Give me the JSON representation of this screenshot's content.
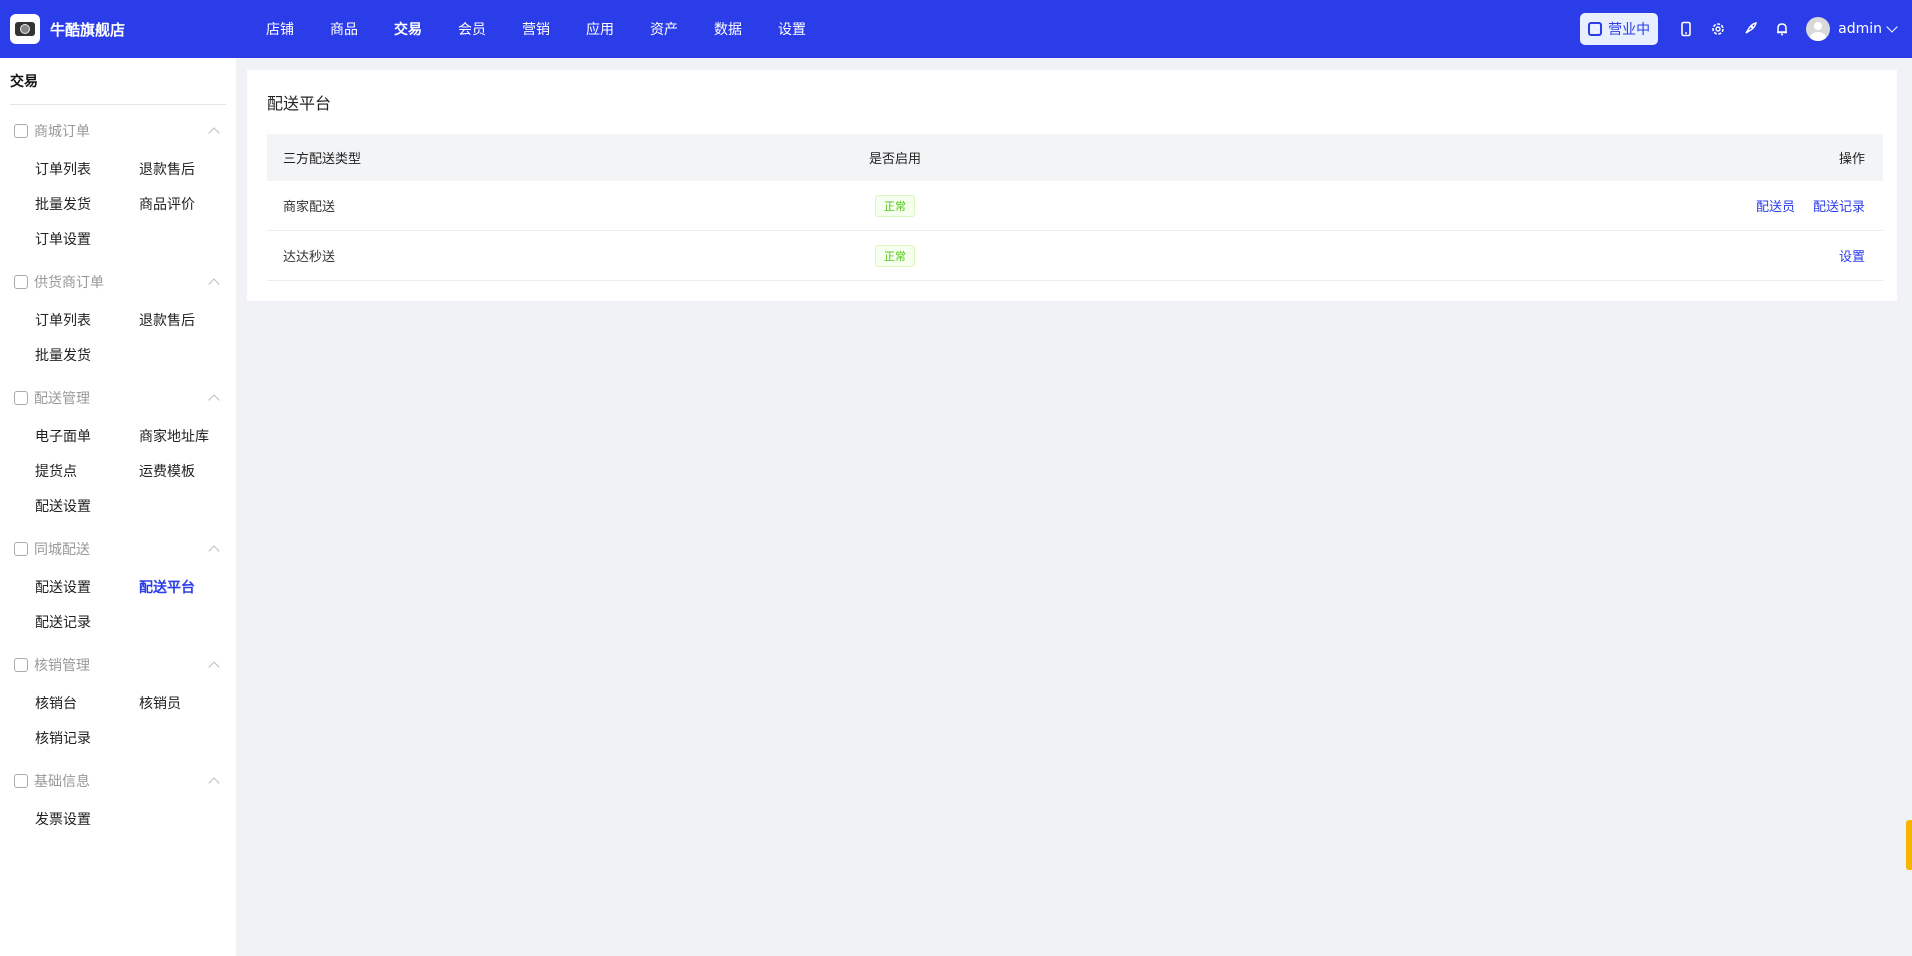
{
  "brand": {
    "name": "牛酷旗舰店",
    "logo_icon": "camera-logo"
  },
  "topnav": [
    {
      "label": "店铺",
      "active": false
    },
    {
      "label": "商品",
      "active": false
    },
    {
      "label": "交易",
      "active": true
    },
    {
      "label": "会员",
      "active": false
    },
    {
      "label": "营销",
      "active": false
    },
    {
      "label": "应用",
      "active": false
    },
    {
      "label": "资产",
      "active": false
    },
    {
      "label": "数据",
      "active": false
    },
    {
      "label": "设置",
      "active": false
    }
  ],
  "header": {
    "status_label": "营业中",
    "username": "admin"
  },
  "sidebar": {
    "title": "交易",
    "groups": [
      {
        "name": "商城订单",
        "icon": "order-icon",
        "items": [
          "订单列表",
          "退款售后",
          "批量发货",
          "商品评价",
          "订单设置"
        ]
      },
      {
        "name": "供货商订单",
        "icon": "supplier-icon",
        "items": [
          "订单列表",
          "退款售后",
          "批量发货"
        ]
      },
      {
        "name": "配送管理",
        "icon": "delivery-icon",
        "items": [
          "电子面单",
          "商家地址库",
          "提货点",
          "运费模板",
          "配送设置"
        ]
      },
      {
        "name": "同城配送",
        "icon": "truck-icon",
        "items": [
          "配送设置",
          "配送平台",
          "配送记录"
        ],
        "active": "配送平台"
      },
      {
        "name": "核销管理",
        "icon": "verify-icon",
        "items": [
          "核销台",
          "核销员",
          "核销记录"
        ]
      },
      {
        "name": "基础信息",
        "icon": "info-icon",
        "items": [
          "发票设置"
        ]
      }
    ]
  },
  "main": {
    "title": "配送平台",
    "columns": [
      "三方配送类型",
      "是否启用",
      "操作"
    ],
    "rows": [
      {
        "type": "商家配送",
        "status": "正常",
        "actions": [
          "配送员",
          "配送记录"
        ]
      },
      {
        "type": "达达秒送",
        "status": "正常",
        "actions": [
          "设置"
        ]
      }
    ]
  },
  "colors": {
    "primary": "#2b3de8",
    "success": "#52c41a"
  }
}
